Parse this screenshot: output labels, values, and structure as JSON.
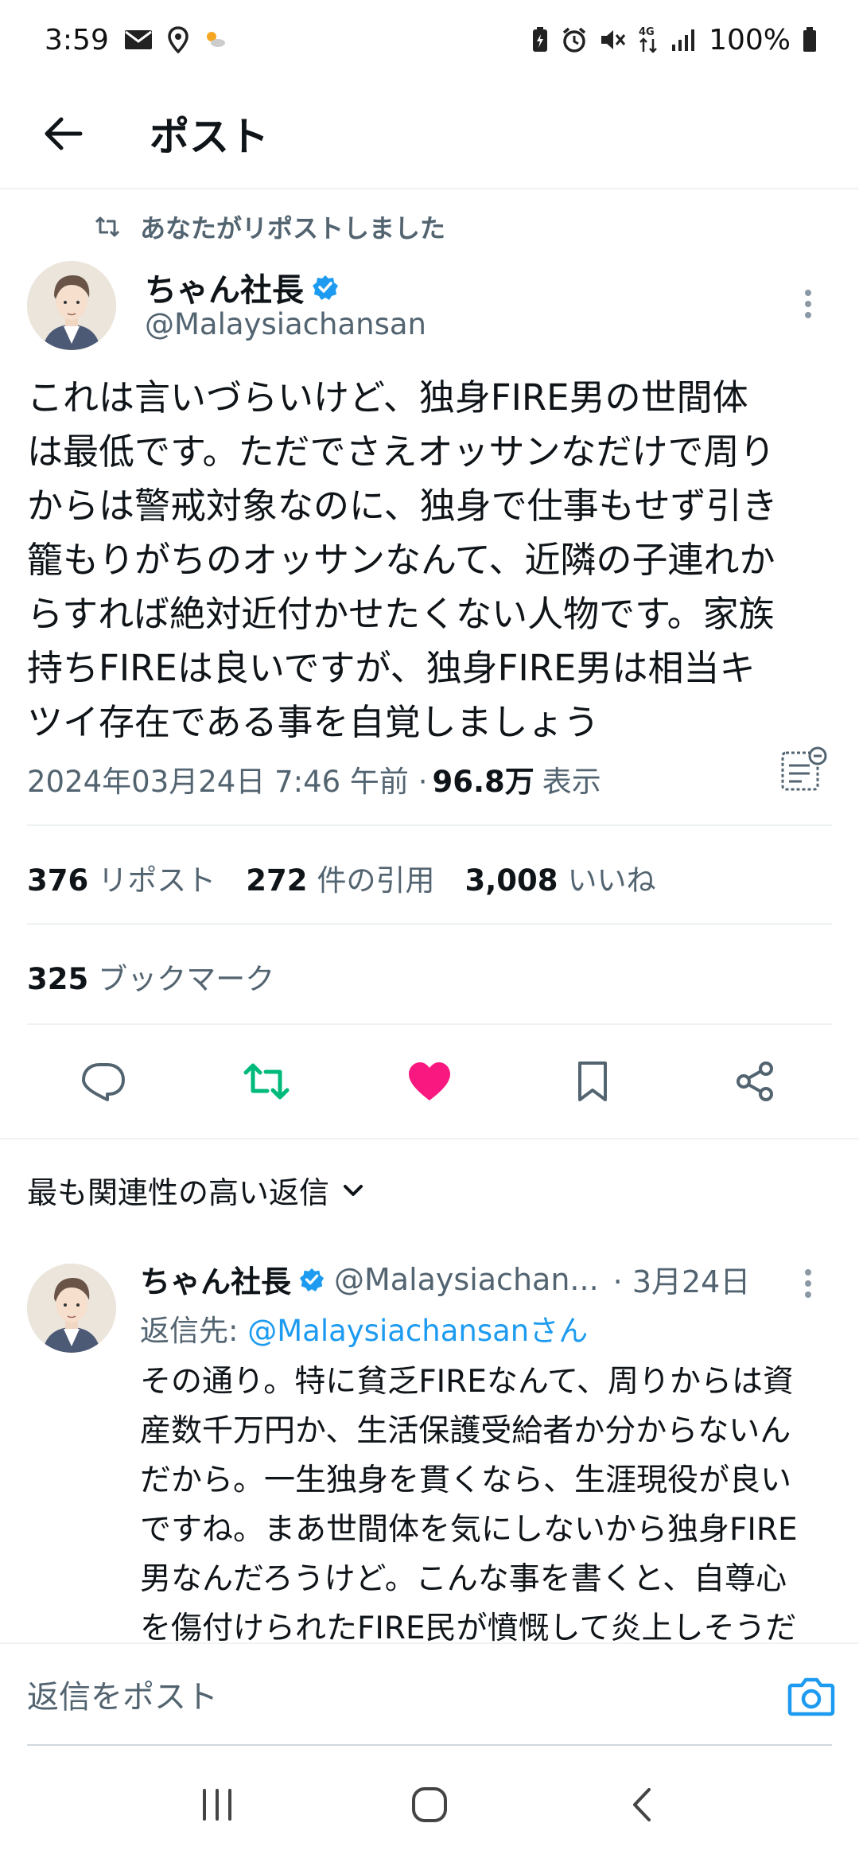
{
  "status_bar": {
    "time": "3:59",
    "battery": "100%",
    "icons": [
      "mail-icon",
      "location-icon",
      "weather-icon",
      "battery-saver-icon",
      "alarm-icon",
      "mute-icon",
      "4g-icon",
      "signal-icon",
      "battery-icon"
    ]
  },
  "app_bar": {
    "title": "ポスト",
    "back_icon": "arrow-left-icon"
  },
  "repost_context": {
    "label": "あなたがリポストしました",
    "icon": "repost-icon"
  },
  "post": {
    "author_name": "ちゃん社長",
    "verified": true,
    "handle": "@Malaysiachansan",
    "text": "これは言いづらいけど、独身FIRE男の世間体\nは最低です。ただでさえオッサンなだけで周り\nからは警戒対象なのに、独身で仕事もせず引き\n籠もりがちのオッサンなんて、近隣の子連れか\nらすれば絶対近付かせたくない人物です。家族\n持ちFIREは良いですが、独身FIRE男は相当キ\nツイ存在である事を自覚しましょう",
    "timestamp": "2024年03月24日 7:46 午前 · ",
    "views_count": "96.8万",
    "views_label": "表示"
  },
  "stats": {
    "reposts_count": "376",
    "reposts_label": "リポスト",
    "quotes_count": "272",
    "quotes_label": "件の引用",
    "likes_count": "3,008",
    "likes_label": "いいね",
    "bookmarks_count": "325",
    "bookmarks_label": "ブックマーク"
  },
  "actions": [
    "reply-icon",
    "repost-icon",
    "like-icon",
    "bookmark-icon",
    "share-icon"
  ],
  "colors": {
    "repost_active": "#00ba7c",
    "like_active": "#f91880",
    "link": "#1d9bf0",
    "verified": "#1d9bf0"
  },
  "sort": {
    "label": "最も関連性の高い返信"
  },
  "reply": {
    "author_name": "ちゃん社長",
    "handle": "@Malaysiachan...",
    "date": "· 3月24日",
    "reply_to_label": "返信先: ",
    "reply_to_handle": "@Malaysiachansanさん",
    "text": "その通り。特に貧乏FIREなんて、周りからは資\n産数千万円か、生活保護受給者か分からないん\nだから。一生独身を貫くなら、生涯現役が良い\nですね。まあ世間体を気にしないから独身FIRE\n男なんだろうけど。こんな事を書くと、自尊心\nを傷付けられたFIRE民が憤慨して炎上しそうだ\nなぁ"
  },
  "composer": {
    "placeholder": "返信をポスト"
  },
  "nav_bar": [
    "recents-icon",
    "home-icon",
    "back-icon"
  ]
}
